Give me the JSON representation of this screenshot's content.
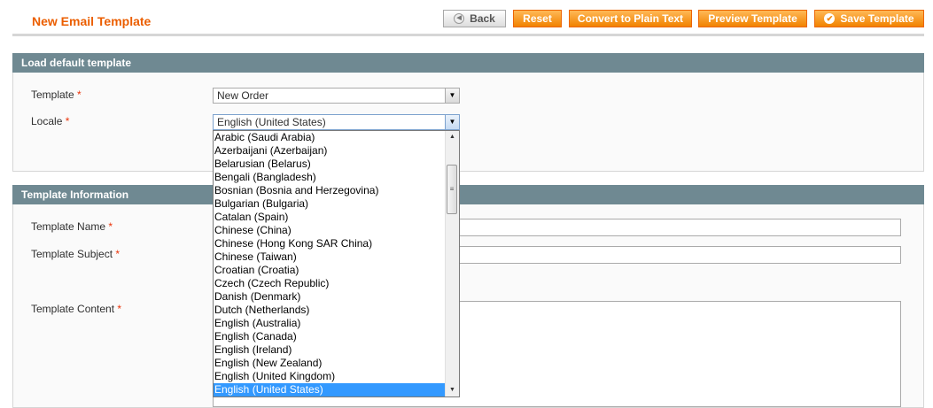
{
  "header": {
    "title": "New Email Template",
    "buttons": {
      "back": "Back",
      "reset": "Reset",
      "convert": "Convert to Plain Text",
      "preview": "Preview Template",
      "save": "Save Template"
    }
  },
  "load_default": {
    "legend": "Load default template",
    "template_label": "Template",
    "template_value": "New Order",
    "locale_label": "Locale",
    "locale_value": "English (United States)",
    "required_mark": "*"
  },
  "locale_options": [
    "Arabic (Saudi Arabia)",
    "Azerbaijani (Azerbaijan)",
    "Belarusian (Belarus)",
    "Bengali (Bangladesh)",
    "Bosnian (Bosnia and Herzegovina)",
    "Bulgarian (Bulgaria)",
    "Catalan (Spain)",
    "Chinese (China)",
    "Chinese (Hong Kong SAR China)",
    "Chinese (Taiwan)",
    "Croatian (Croatia)",
    "Czech (Czech Republic)",
    "Danish (Denmark)",
    "Dutch (Netherlands)",
    "English (Australia)",
    "English (Canada)",
    "English (Ireland)",
    "English (New Zealand)",
    "English (United Kingdom)",
    "English (United States)"
  ],
  "selected_locale_index": 19,
  "template_info": {
    "legend": "Template Information",
    "name_label": "Template Name",
    "subject_label": "Template Subject",
    "content_label": "Template Content",
    "name_value": "",
    "subject_value": ""
  },
  "colors": {
    "accent": "#eb5e00",
    "button": "#f18200",
    "section_header": "#6f8992",
    "selection": "#3399ff"
  }
}
